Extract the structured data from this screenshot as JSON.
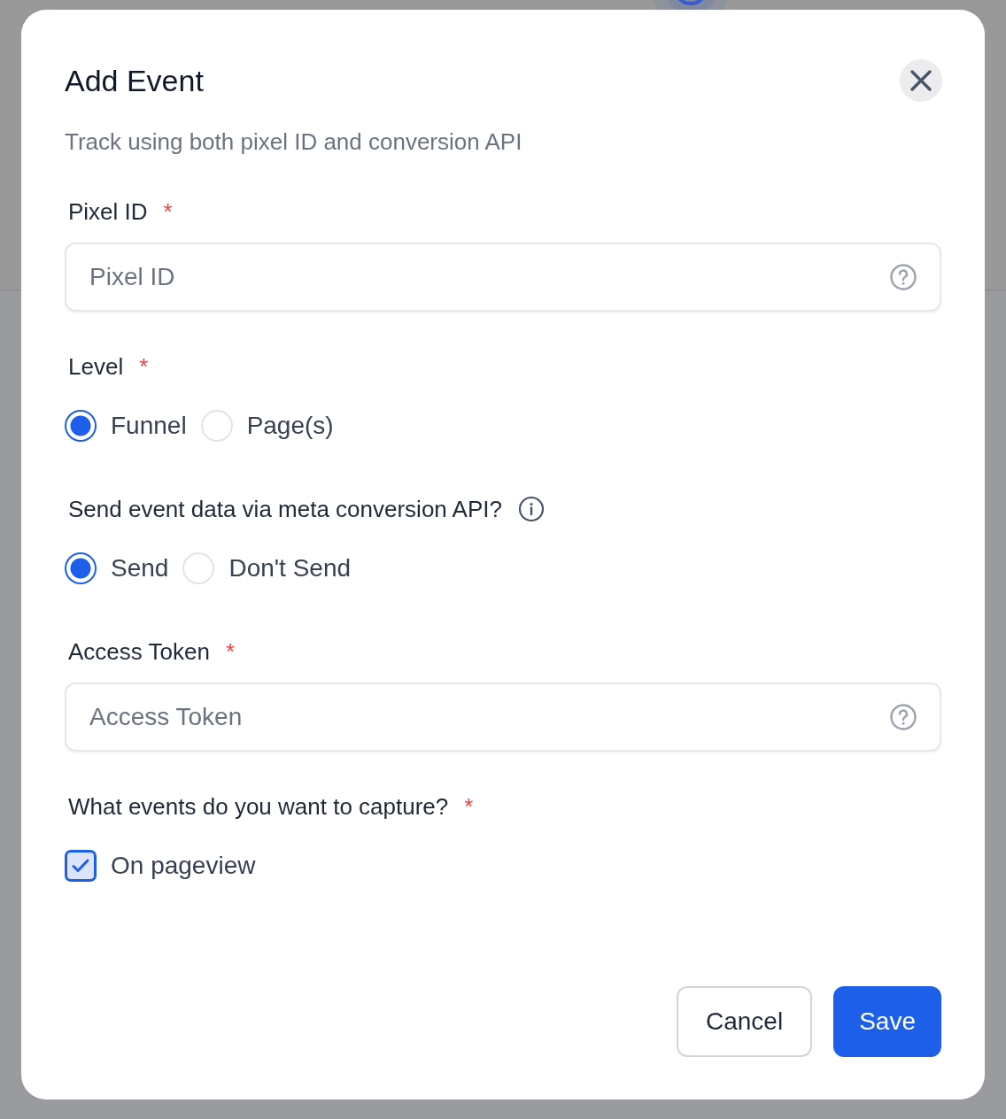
{
  "dialog": {
    "title": "Add Event",
    "subtitle": "Track using both pixel ID and conversion API",
    "fields": [
      {
        "kind": "input",
        "label": "Pixel ID",
        "marker": "*",
        "placeholder": "Pixel ID",
        "help": true
      },
      {
        "kind": "radio",
        "label": "Level",
        "marker": "*",
        "options": [
          {
            "label": "Funnel",
            "selected": true
          },
          {
            "label": "Page(s)",
            "selected": false
          }
        ]
      },
      {
        "kind": "radio",
        "label": "Send event data via meta conversion API?",
        "info": true,
        "options": [
          {
            "label": "Send",
            "selected": true
          },
          {
            "label": "Don't Send",
            "selected": false
          }
        ]
      },
      {
        "kind": "input",
        "label": "Access Token",
        "marker": "*",
        "placeholder": "Access Token",
        "help": true
      },
      {
        "kind": "checkbox",
        "label": "What events do you want to capture?",
        "marker": "*",
        "options": [
          {
            "label": "On pageview",
            "checked": true
          }
        ]
      }
    ],
    "buttons": [
      {
        "label": "Cancel",
        "kind": "secondary"
      },
      {
        "label": "Save",
        "kind": "primary"
      }
    ]
  }
}
